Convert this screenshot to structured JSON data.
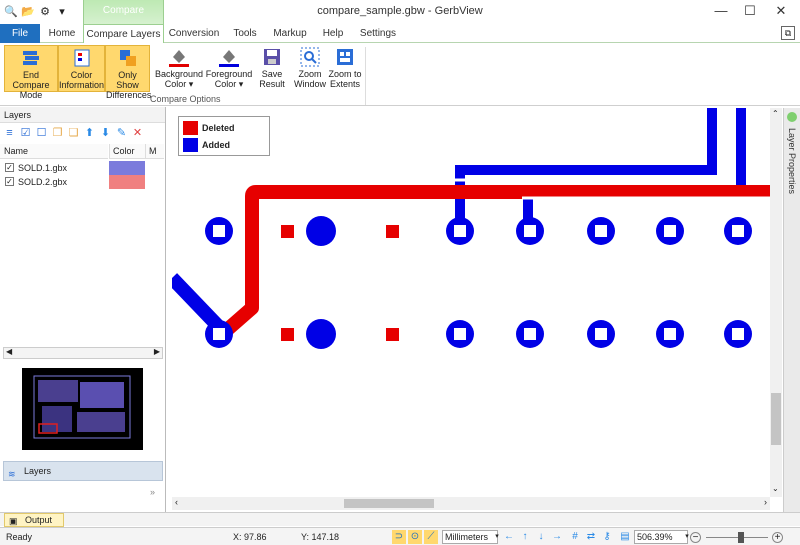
{
  "window": {
    "title": "compare_sample.gbw - GerbView",
    "context_tab": "Compare",
    "minimize": "—",
    "maximize": "☐",
    "close": "✕"
  },
  "quick_access": [
    "🔍",
    "📂",
    "⚙",
    "▾"
  ],
  "tabs": [
    {
      "label": "File"
    },
    {
      "label": "Home"
    },
    {
      "label": "Compare Layers"
    },
    {
      "label": "Conversion"
    },
    {
      "label": "Tools"
    },
    {
      "label": "Markup"
    },
    {
      "label": "Help"
    },
    {
      "label": "Settings"
    }
  ],
  "ribbon": {
    "buttons": [
      {
        "label1": "End Compare",
        "label2": "Mode",
        "icon": "end-compare-icon"
      },
      {
        "label1": "Color",
        "label2": "Information",
        "icon": "color-information-icon"
      },
      {
        "label1": "Only Show",
        "label2": "Differences",
        "icon": "only-show-differences-icon"
      },
      {
        "label1": "Background",
        "label2": "Color ▾",
        "icon": "background-color-icon"
      },
      {
        "label1": "Foreground",
        "label2": "Color ▾",
        "icon": "foreground-color-icon"
      },
      {
        "label1": "Save",
        "label2": "Result",
        "icon": "save-icon"
      },
      {
        "label1": "Zoom",
        "label2": "Window",
        "icon": "zoom-window-icon"
      },
      {
        "label1": "Zoom to",
        "label2": "Extents",
        "icon": "zoom-extents-icon"
      }
    ],
    "group_label": "Compare Options",
    "background_color_bar": "#e00000",
    "foreground_color_bar": "#0000dd"
  },
  "left_panel": {
    "title": "Layers",
    "columns": {
      "name": "Name",
      "color": "Color",
      "m": "M"
    },
    "layers": [
      {
        "name": "SOLD.1.gbx",
        "checked": "✓",
        "color": "#7b7bdc"
      },
      {
        "name": "SOLD.2.gbx",
        "checked": "✓",
        "color": "#f08080"
      }
    ],
    "layers_button": "Layers",
    "more": "»"
  },
  "legend": {
    "deleted_label": "Deleted",
    "deleted_color": "#e60000",
    "added_label": "Added",
    "added_color": "#0000e6"
  },
  "right_sidebar": {
    "label": "Layer Properties"
  },
  "output": {
    "label": "Output"
  },
  "status": {
    "ready": "Ready",
    "x": "X: 97.86",
    "y": "Y: 147.18",
    "units": "Millimeters",
    "zoom": "506.39%"
  }
}
